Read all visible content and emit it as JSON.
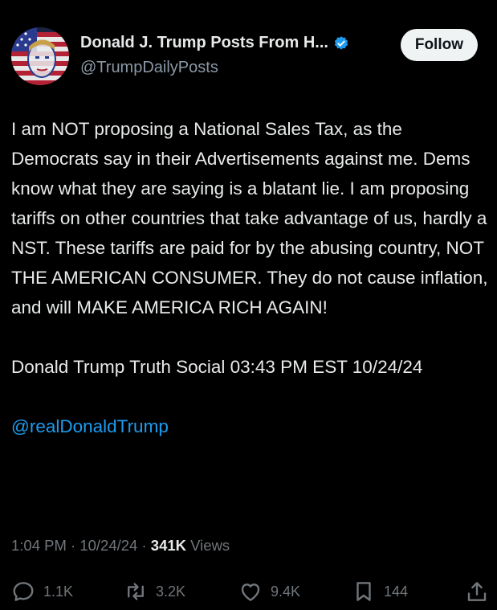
{
  "post": {
    "author": {
      "display_name": "Donald J. Trump Posts From H...",
      "handle": "@TrumpDailyPosts",
      "verified": true,
      "verified_color": "#1d9bf0"
    },
    "follow_label": "Follow",
    "text": "I am NOT proposing a National Sales Tax, as the Democrats say in their Advertisements against me. Dems know what they are saying is a blatant lie. I am proposing tariffs on other countries that take advantage of us, hardly a NST. These tariffs are paid for by the abusing country, NOT THE AMERICAN CONSUMER. They do not cause inflation, and will MAKE AMERICA RICH AGAIN!",
    "source_line": "Donald Trump Truth Social 03:43 PM EST 10/24/24",
    "mention": "@realDonaldTrump",
    "timestamp": "1:04 PM · 10/24/24 · ",
    "views_count": "341K",
    "views_label": " Views"
  },
  "actions": {
    "replies": "1.1K",
    "reposts": "3.2K",
    "likes": "9.4K",
    "bookmarks": "144"
  },
  "icons": {
    "reply": "reply-icon",
    "repost": "repost-icon",
    "like": "heart-icon",
    "bookmark": "bookmark-icon",
    "share": "share-icon",
    "verified": "verified-badge-icon"
  },
  "colors": {
    "background": "#000000",
    "text_primary": "#e7e9ea",
    "text_secondary": "#71767b",
    "link": "#1d9bf0",
    "follow_bg": "#eff3f4"
  }
}
